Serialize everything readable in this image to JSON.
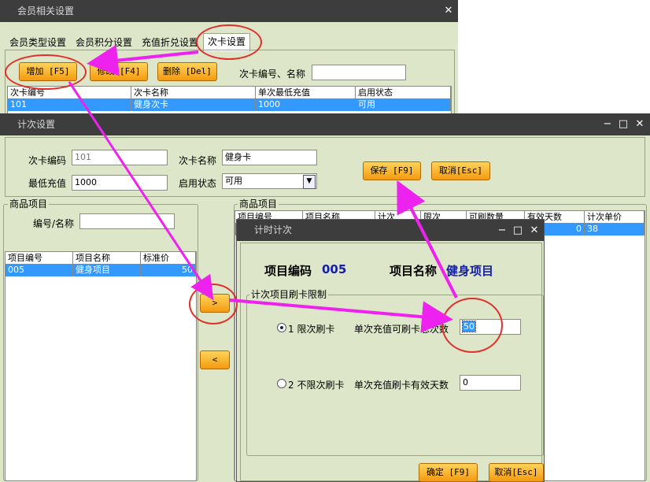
{
  "win1": {
    "title": "会员相关设置",
    "close": "✕",
    "tabs": [
      "会员类型设置",
      "会员积分设置",
      "充值折兑设置",
      "次卡设置"
    ],
    "buttons": {
      "add": "增加 [F5]",
      "edit": "修改 [F4]",
      "delete": "删除 [Del]"
    },
    "search_label": "次卡编号、名称",
    "search_value": "",
    "table": {
      "headers": [
        "次卡编号",
        "次卡名称",
        "单次最低充值",
        "启用状态"
      ],
      "rows": [
        [
          "101",
          "健身次卡",
          "1000",
          "可用"
        ]
      ]
    }
  },
  "win2": {
    "title": "计次设置",
    "controls": {
      "min": "−",
      "max": "□",
      "close": "✕"
    },
    "fields": {
      "code_label": "次卡编码",
      "code_value": "101",
      "name_label": "次卡名称",
      "name_value": "健身卡",
      "min_label": "最低充值",
      "min_value": "1000",
      "status_label": "启用状态",
      "status_value": "可用"
    },
    "buttons": {
      "save": "保存 [F9]",
      "cancel": "取消[Esc]"
    },
    "goods": {
      "legend": "商品项目",
      "search_label": "编号/名称",
      "headers": [
        "项目编号",
        "项目名称",
        "标准价"
      ],
      "rows": [
        [
          "005",
          "健身项目",
          "50"
        ]
      ]
    },
    "items": {
      "legend": "商品项目",
      "headers": [
        "项目编号",
        "项目名称",
        "计次",
        "限次",
        "可刷数量",
        "有效天数",
        "计次单价"
      ],
      "rows": [
        [
          "",
          "",
          "",
          "",
          "",
          "0",
          "38"
        ]
      ]
    },
    "move_right": ">",
    "move_left": "<"
  },
  "dialog": {
    "title": "计时计次",
    "controls": {
      "min": "−",
      "max": "□",
      "close": "✕"
    },
    "code_label": "项目编码",
    "code_value": "005",
    "name_label": "项目名称",
    "name_value": "健身项目",
    "group_legend": "计次项目刷卡限制",
    "option1": {
      "label": "1 限次刷卡",
      "field_label": "单次充值可刷卡总次数",
      "value": "50"
    },
    "option2": {
      "label": "2 不限次刷卡",
      "field_label": "单次充值刷卡有效天数",
      "value": "0"
    },
    "buttons": {
      "ok": "确定 [F9]",
      "cancel": "取消[Esc]"
    }
  },
  "colors": {
    "accent_orange": "#f39a10",
    "highlight_blue": "#3399ff",
    "annotation_magenta": "#ee22ee",
    "annotation_red": "#e0302c"
  }
}
